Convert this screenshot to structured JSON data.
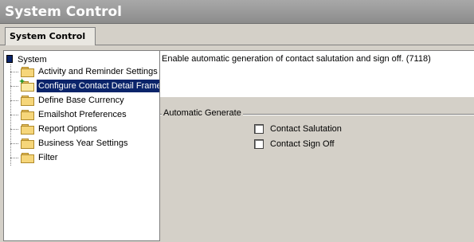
{
  "window": {
    "title": "System Control"
  },
  "tabs": [
    {
      "label": "System Control",
      "active": true
    }
  ],
  "tree": {
    "root": {
      "label": "System",
      "icon": "system-icon"
    },
    "items": [
      {
        "label": "Activity and Reminder Settings",
        "icon": "folder-icon",
        "selected": false
      },
      {
        "label": "Configure Contact Detail Frame",
        "icon": "folder-open-icon",
        "selected": true
      },
      {
        "label": "Define Base Currency",
        "icon": "folder-icon",
        "selected": false
      },
      {
        "label": "Emailshot Preferences",
        "icon": "folder-icon",
        "selected": false
      },
      {
        "label": "Report Options",
        "icon": "folder-icon",
        "selected": false
      },
      {
        "label": "Business Year Settings",
        "icon": "folder-icon",
        "selected": false
      },
      {
        "label": "Filter",
        "icon": "folder-icon",
        "selected": false
      }
    ]
  },
  "description": {
    "text": "Enable automatic generation of contact salutation and sign off. (7118)"
  },
  "group": {
    "legend": "Automatic Generate",
    "options": [
      {
        "label": "Contact Salutation",
        "checked": false
      },
      {
        "label": "Contact Sign Off",
        "checked": false
      }
    ]
  },
  "colors": {
    "selection": "#0a246a",
    "panel": "#d4d0c8",
    "titlebar": "#8c8c8c"
  }
}
